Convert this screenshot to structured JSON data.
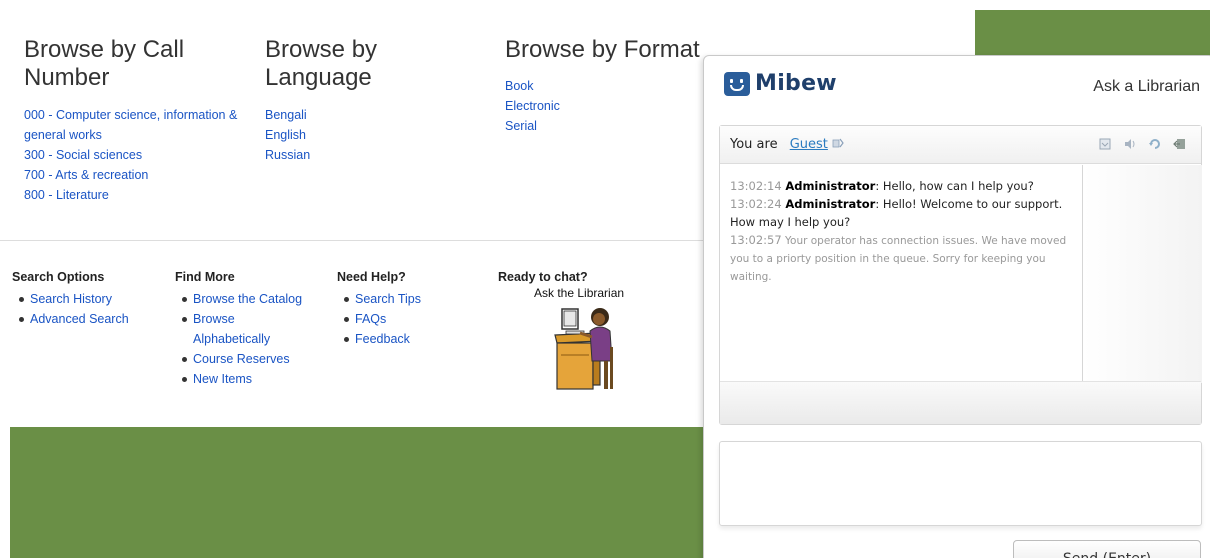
{
  "browse": {
    "call_number": {
      "title": "Browse by Call Number",
      "items": [
        "000 - Computer science, information & general works",
        "300 - Social sciences",
        "700 - Arts & recreation",
        "800 - Literature"
      ]
    },
    "language": {
      "title": "Browse by Language",
      "items": [
        "Bengali",
        "English",
        "Russian"
      ]
    },
    "format": {
      "title": "Browse by Format",
      "items": [
        "Book",
        "Electronic",
        "Serial"
      ]
    }
  },
  "footer": {
    "search_options": {
      "title": "Search Options",
      "items": [
        "Search History",
        "Advanced Search"
      ]
    },
    "find_more": {
      "title": "Find More",
      "items": [
        "Browse the Catalog",
        "Browse Alphabetically",
        "Course Reserves",
        "New Items"
      ]
    },
    "need_help": {
      "title": "Need Help?",
      "items": [
        "Search Tips",
        "FAQs",
        "Feedback"
      ]
    },
    "chat": {
      "title": "Ready to chat?",
      "subtitle": "Ask the Librarian"
    }
  },
  "chat_widget": {
    "logo_text": "Mibew",
    "header_title": "Ask a Librarian",
    "you_are_label": "You are",
    "user_name": "Guest",
    "messages": [
      {
        "time": "13:02:14",
        "author": "Administrator",
        "text": ": Hello, how can I help you?"
      },
      {
        "time": "13:02:24",
        "author": "Administrator",
        "text": ": Hello! Welcome to our support. How may I help you?"
      },
      {
        "time": "13:02:57",
        "text": "Your operator has connection issues. We have moved you to a priorty position in the queue. Sorry for keeping you waiting."
      }
    ],
    "send_label": "Send (Enter)",
    "input_value": ""
  },
  "colors": {
    "accent_green": "#6a8f46",
    "link": "#1a54c4",
    "mibew_blue": "#2a5d9a"
  }
}
